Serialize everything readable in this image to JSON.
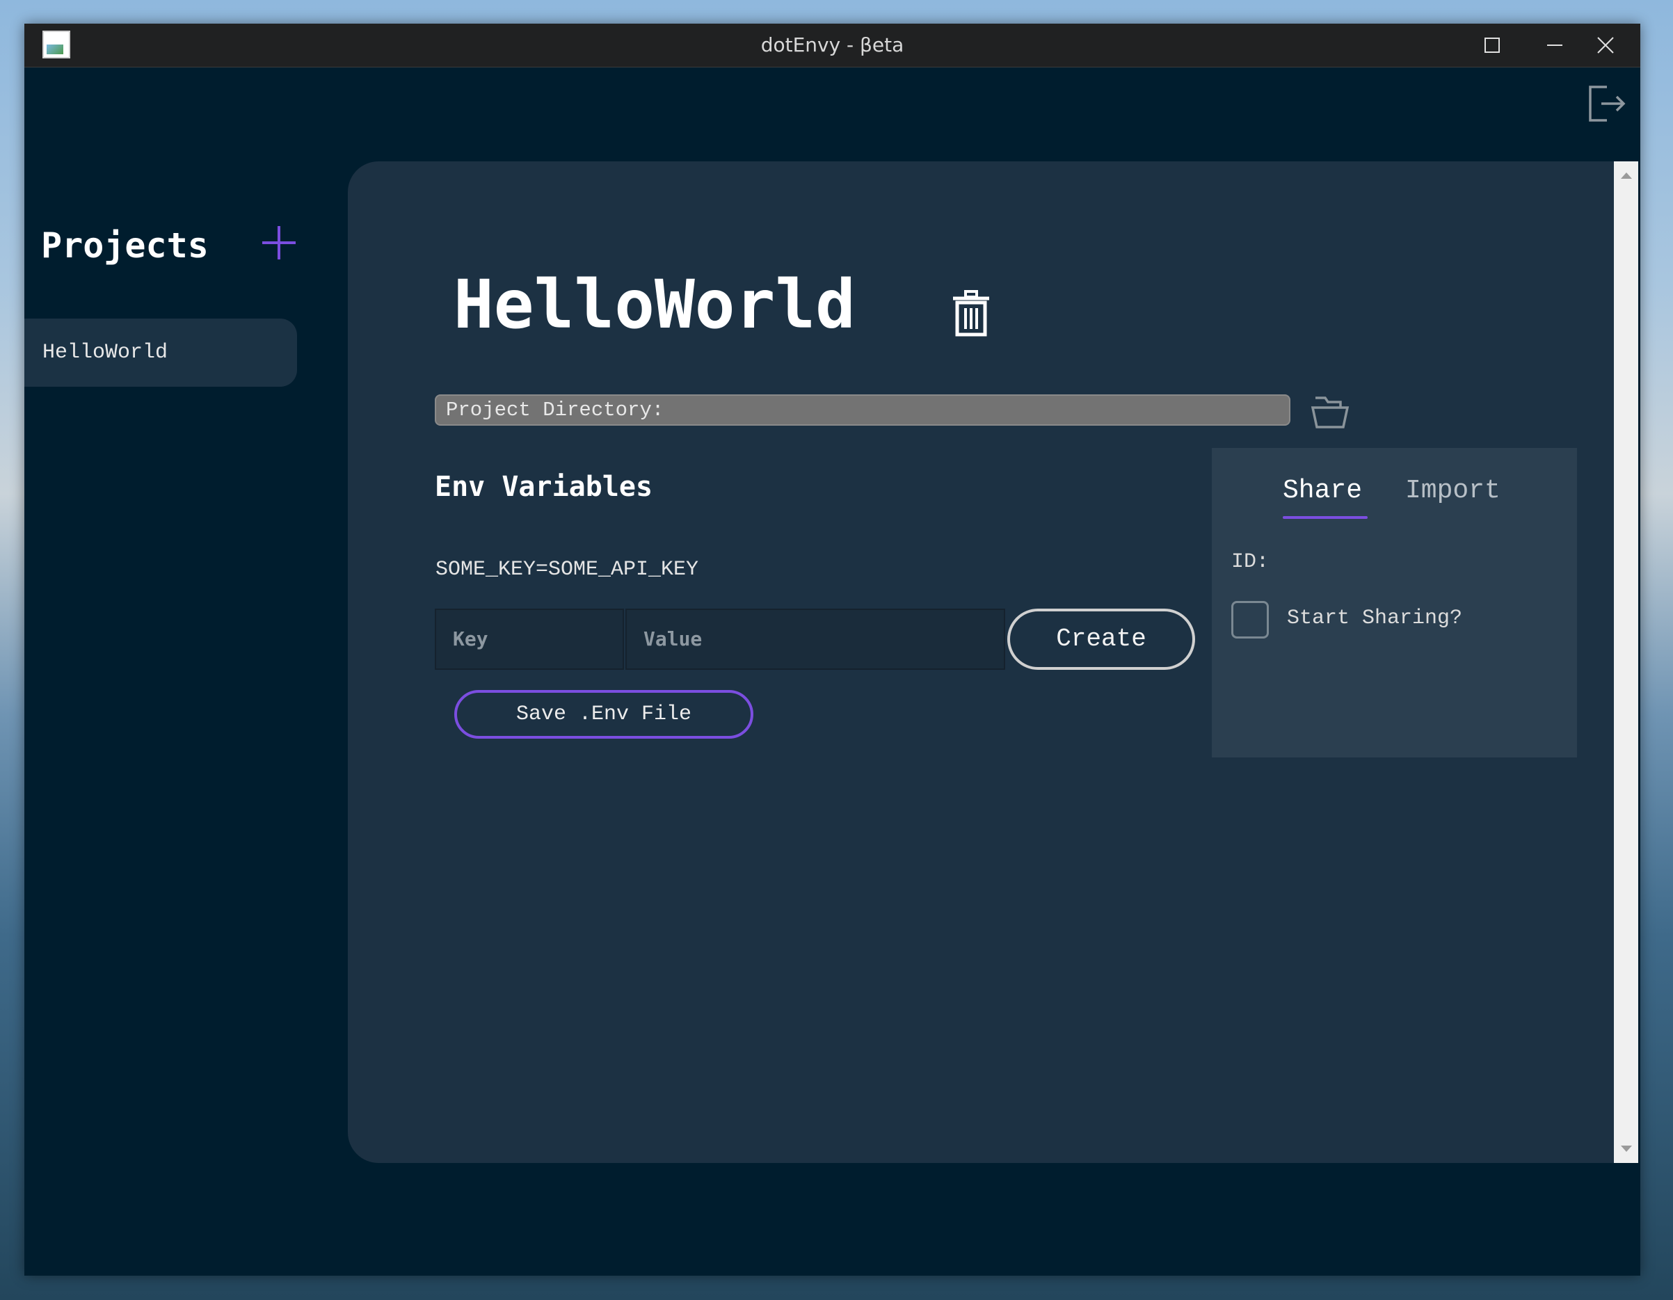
{
  "window": {
    "title": "dotEnvy - βeta"
  },
  "sidebar": {
    "title": "Projects",
    "items": [
      {
        "label": "HelloWorld"
      }
    ]
  },
  "project": {
    "title": "HelloWorld",
    "directory_label": "Project Directory:"
  },
  "env": {
    "title": "Env Variables",
    "variables": [
      "SOME_KEY=SOME_API_KEY"
    ],
    "key_placeholder": "Key",
    "value_placeholder": "Value",
    "create_label": "Create",
    "save_label": "Save .Env File"
  },
  "share": {
    "tabs": [
      {
        "label": "Share",
        "active": true
      },
      {
        "label": "Import",
        "active": false
      }
    ],
    "id_label": "ID:",
    "sharing_label": "Start Sharing?",
    "sharing_checked": false
  },
  "icons": {
    "app": "app-icon",
    "minimize": "minimize-icon",
    "maximize": "maximize-icon",
    "close": "close-icon",
    "logout": "logout-icon",
    "add": "plus-icon",
    "delete": "trash-icon",
    "folder": "folder-open-icon"
  },
  "colors": {
    "window_bg": "#001d2e",
    "panel_bg": "#1c3143",
    "share_bg": "#2b3f50",
    "accent": "#7b4ee0"
  }
}
